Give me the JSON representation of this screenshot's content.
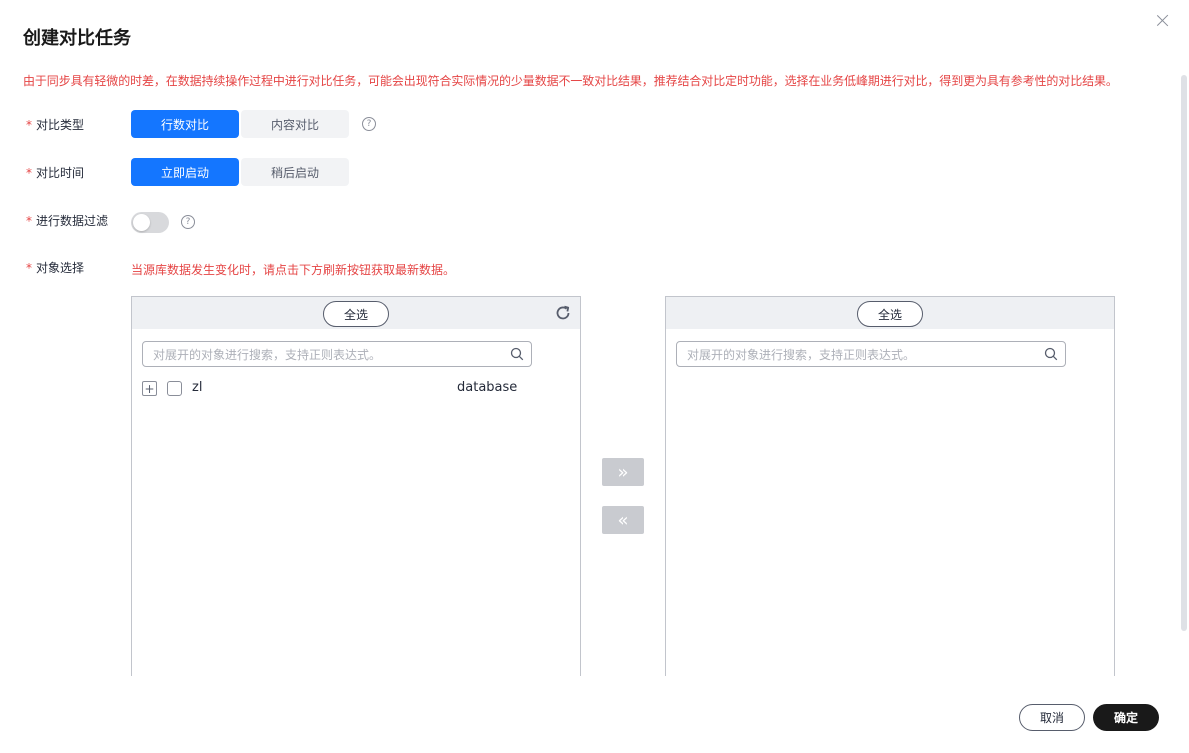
{
  "dialog": {
    "title": "创建对比任务",
    "warning": "由于同步具有轻微的时差，在数据持续操作过程中进行对比任务，可能会出现符合实际情况的少量数据不一致对比结果，推荐结合对比定时功能，选择在业务低峰期进行对比，得到更为具有参考性的对比结果。"
  },
  "form": {
    "compare_type": {
      "label": "对比类型",
      "options": [
        "行数对比",
        "内容对比"
      ],
      "selected": "行数对比"
    },
    "compare_time": {
      "label": "对比时间",
      "options": [
        "立即启动",
        "稍后启动"
      ],
      "selected": "立即启动"
    },
    "data_filter": {
      "label": "进行数据过滤",
      "enabled": false
    },
    "object_select": {
      "label": "对象选择",
      "hint": "当源库数据发生变化时，请点击下方刷新按钮获取最新数据。"
    },
    "required_mark": "*",
    "help_glyph": "?"
  },
  "transfer": {
    "left": {
      "select_all": "全选",
      "search_placeholder": "对展开的对象进行搜索，支持正则表达式。",
      "items": [
        {
          "expand": "+",
          "name": "zl",
          "type": "database"
        }
      ]
    },
    "right": {
      "select_all": "全选",
      "search_placeholder": "对展开的对象进行搜索，支持正则表达式。",
      "items": []
    },
    "move_right": "»",
    "move_left": "«"
  },
  "footer": {
    "cancel": "取消",
    "ok": "确定"
  },
  "colors": {
    "accent": "#1476ff",
    "warning": "#e54545",
    "primary_button": "#191919"
  }
}
